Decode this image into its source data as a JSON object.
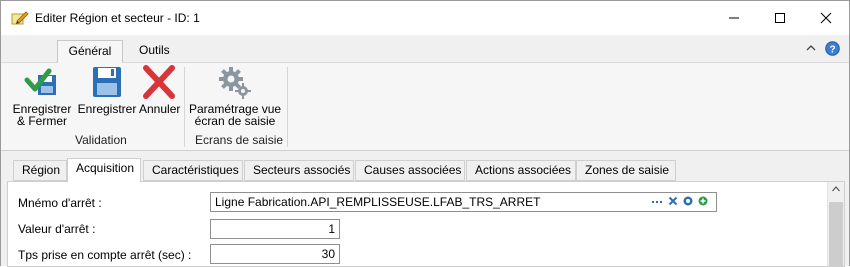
{
  "window": {
    "title": "Editer Région et secteur - ID: 1",
    "icon": "edit-pencil-icon",
    "controls": [
      "minimize-icon",
      "maximize-icon",
      "close-icon"
    ]
  },
  "ribbon": {
    "tabs": [
      {
        "label": "Général",
        "active": true
      },
      {
        "label": "Outils",
        "active": false
      }
    ],
    "groups": [
      {
        "label": "Validation",
        "buttons": [
          {
            "label": "Enregistrer\n& Fermer",
            "icon": "save-close-icon"
          },
          {
            "label": "Enregistrer",
            "icon": "floppy-disk-icon"
          },
          {
            "label": "Annuler",
            "icon": "red-x-icon"
          }
        ]
      },
      {
        "label": "Ecrans de saisie",
        "buttons": [
          {
            "label": "Paramétrage vue\nécran de saisie",
            "icon": "gears-icon"
          }
        ]
      }
    ],
    "right_icons": [
      "collapse-ribbon-icon",
      "help-icon"
    ]
  },
  "form_tabs": [
    {
      "label": "Région",
      "active": false
    },
    {
      "label": "Acquisition",
      "active": true
    },
    {
      "label": "Caractéristiques",
      "active": false
    },
    {
      "label": "Secteurs associés",
      "active": false
    },
    {
      "label": "Causes associées",
      "active": false
    },
    {
      "label": "Actions associées",
      "active": false
    },
    {
      "label": "Zones de saisie",
      "active": false
    }
  ],
  "fields": {
    "mnemo": {
      "label": "Mnémo d'arrêt :",
      "value": "Ligne Fabrication.API_REMPLISSEUSE.LFAB_TRS_ARRET"
    },
    "valeur": {
      "label": "Valeur d'arrêt :",
      "value": "1"
    },
    "tps": {
      "label": "Tps prise en compte arrêt (sec) :",
      "value": "30"
    }
  },
  "colors": {
    "green": "#2e9a4a",
    "blue": "#2d6fb5",
    "red": "#d9343a",
    "gray": "#8b96a0"
  }
}
